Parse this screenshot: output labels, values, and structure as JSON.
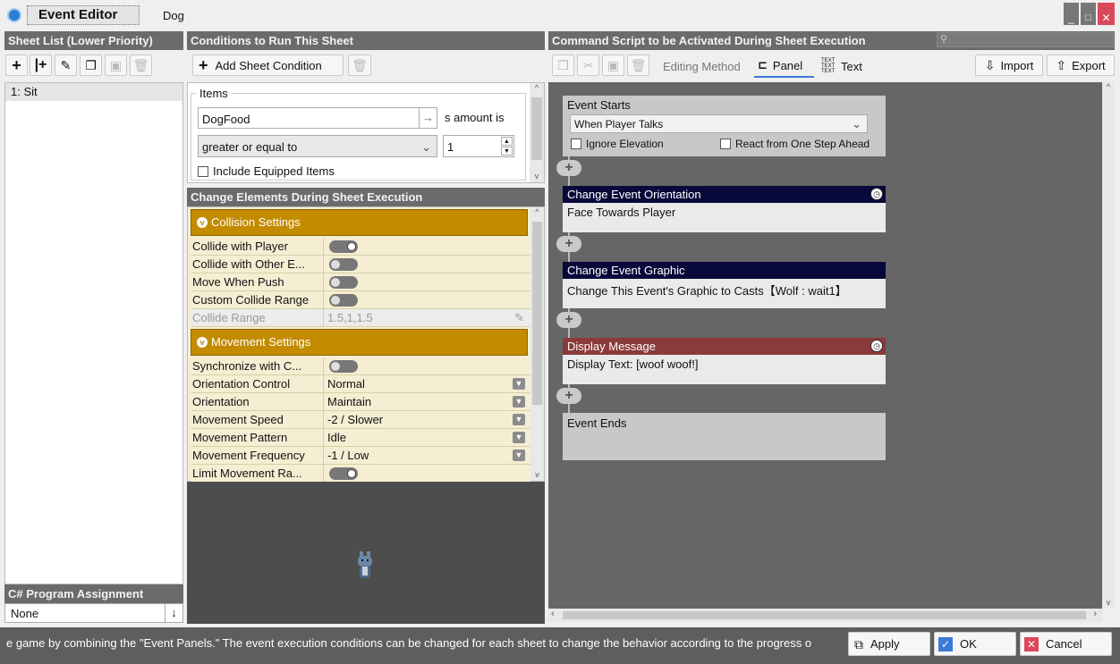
{
  "titlebar": {
    "title": "Event Editor",
    "event_name": "Dog"
  },
  "sheet_list": {
    "header": "Sheet List (Lower Priority)",
    "items": [
      "1: Sit"
    ],
    "csharp_header": "C# Program Assignment",
    "csharp_value": "None"
  },
  "conditions": {
    "header": "Conditions to Run This Sheet",
    "add_label": "Add Sheet Condition",
    "group_label": "Items",
    "item_value": "DogFood",
    "amount_text": "s amount is",
    "comparison": "greater or equal to",
    "amount": "1",
    "include_equipped": "Include Equipped Items"
  },
  "change_elements": {
    "header": "Change Elements During Sheet Execution",
    "collision_header": "Collision Settings",
    "collision_rows": [
      {
        "label": "Collide with Player",
        "toggle": true
      },
      {
        "label": "Collide with Other E...",
        "toggle": false
      },
      {
        "label": "Move When Push",
        "toggle": false
      },
      {
        "label": "Custom Collide Range",
        "toggle": false
      }
    ],
    "collide_range_label": "Collide Range",
    "collide_range_value": "1.5,1,1.5",
    "movement_header": "Movement Settings",
    "sync_label": "Synchronize with C...",
    "movement_rows": [
      {
        "label": "Orientation Control",
        "value": "Normal"
      },
      {
        "label": "Orientation",
        "value": "Maintain"
      },
      {
        "label": "Movement Speed",
        "value": "-2 / Slower"
      },
      {
        "label": "Movement Pattern",
        "value": "Idle"
      },
      {
        "label": "Movement Frequency",
        "value": "-1 / Low"
      }
    ],
    "limit_label": "Limit Movement Ra..."
  },
  "command_script": {
    "header": "Command Script to be Activated During Sheet Execution",
    "editing_method": "Editing Method",
    "panel_label": "Panel",
    "text_label": "Text",
    "import_label": "Import",
    "export_label": "Export",
    "event_starts": "Event Starts",
    "trigger": "When Player Talks",
    "ignore_elevation": "Ignore Elevation",
    "react_ahead": "React from One Step Ahead",
    "panels": [
      {
        "title": "Change Event Orientation",
        "body": "Face Towards Player",
        "color": "#08083a"
      },
      {
        "title": "Change Event Graphic",
        "body": "Change This Event's Graphic to Casts【Wolf : wait1】",
        "color": "#08083a"
      },
      {
        "title": "Display Message",
        "body": "Display Text: [woof woof!]",
        "color": "#8a3a3a"
      }
    ],
    "event_ends": "Event Ends"
  },
  "footer": {
    "hint": "e game by combining the \"Event Panels.\" The event execution conditions can be changed for each sheet to change the behavior according to the progress o",
    "apply": "Apply",
    "ok": "OK",
    "cancel": "Cancel"
  },
  "colors": {
    "accent": "#c38b00",
    "header_bg": "#6b6b6b",
    "panel_title": "#08083a",
    "message_title": "#8a3a3a",
    "canvas": "#666666"
  }
}
